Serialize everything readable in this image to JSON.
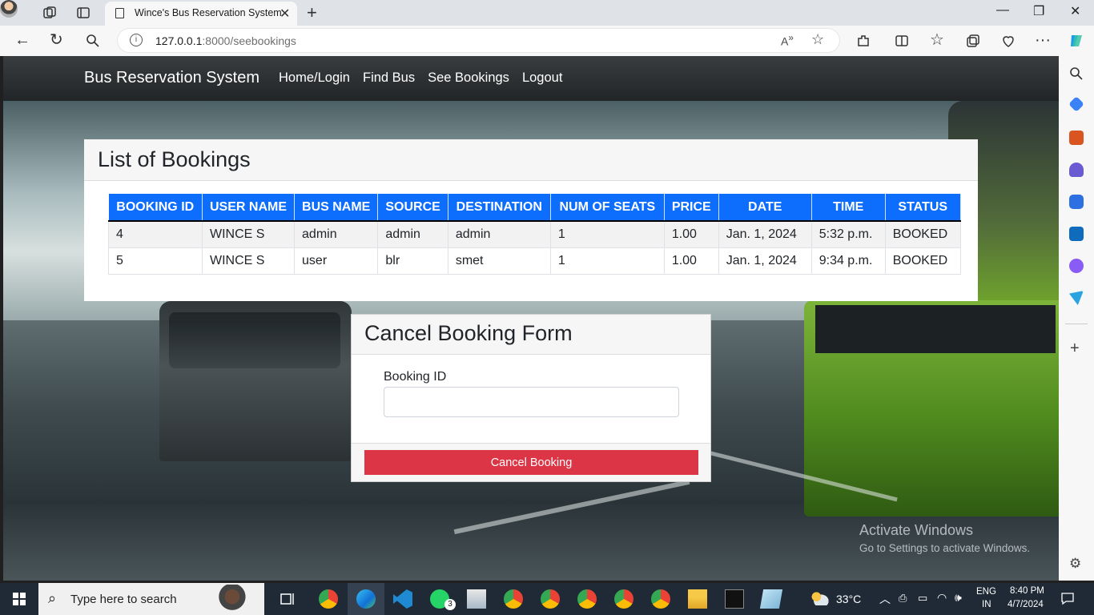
{
  "browser": {
    "tab_title": "Wince's Bus Reservation System",
    "url_host": "127.0.0.1",
    "url_rest": ":8000/seebookings"
  },
  "navbar": {
    "brand": "Bus Reservation System",
    "links": [
      "Home/Login",
      "Find Bus",
      "See Bookings",
      "Logout"
    ]
  },
  "bookings": {
    "title": "List of Bookings",
    "columns": [
      "BOOKING ID",
      "USER NAME",
      "BUS NAME",
      "SOURCE",
      "DESTINATION",
      "NUM OF SEATS",
      "PRICE",
      "DATE",
      "TIME",
      "STATUS"
    ],
    "rows": [
      [
        "4",
        "WINCE S",
        "admin",
        "admin",
        "admin",
        "1",
        "1.00",
        "Jan. 1, 2024",
        "5:32 p.m.",
        "BOOKED"
      ],
      [
        "5",
        "WINCE S",
        "user",
        "blr",
        "smet",
        "1",
        "1.00",
        "Jan. 1, 2024",
        "9:34 p.m.",
        "BOOKED"
      ]
    ]
  },
  "cancel_form": {
    "title": "Cancel Booking Form",
    "field_label": "Booking ID",
    "field_value": "",
    "submit_label": "Cancel Booking"
  },
  "watermark": {
    "line1": "Activate Windows",
    "line2": "Go to Settings to activate Windows."
  },
  "taskbar": {
    "search_placeholder": "Type here to search",
    "whatsapp_badge": "3",
    "temperature": "33°C",
    "lang": "ENG",
    "region": "IN",
    "time": "8:40 PM",
    "date": "4/7/2024"
  },
  "colors": {
    "primary": "#0d6efd",
    "danger": "#dc3545",
    "navbar": "#222527"
  }
}
